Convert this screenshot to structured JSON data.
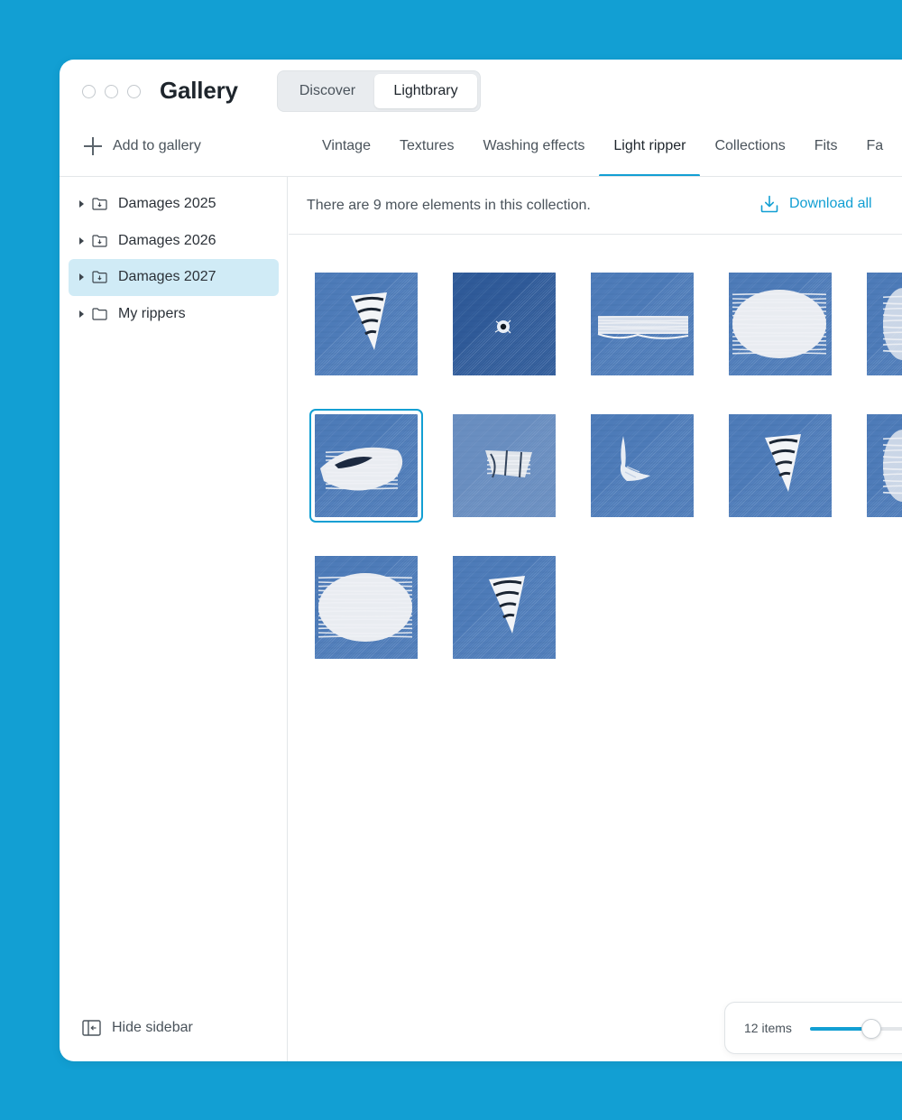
{
  "window": {
    "title": "Gallery",
    "segments": [
      {
        "label": "Discover",
        "active": false
      },
      {
        "label": "Lightbrary",
        "active": true
      }
    ]
  },
  "toolbar": {
    "add_label": "Add to gallery"
  },
  "tabs": [
    {
      "label": "Vintage",
      "active": false
    },
    {
      "label": "Textures",
      "active": false
    },
    {
      "label": "Washing effects",
      "active": false
    },
    {
      "label": "Light ripper",
      "active": true
    },
    {
      "label": "Collections",
      "active": false
    },
    {
      "label": "Fits",
      "active": false
    },
    {
      "label": "Fa",
      "active": false
    }
  ],
  "sidebar": {
    "items": [
      {
        "label": "Damages 2025",
        "icon": "folder-download-icon",
        "selected": false
      },
      {
        "label": "Damages 2026",
        "icon": "folder-download-icon",
        "selected": false
      },
      {
        "label": "Damages 2027",
        "icon": "folder-download-icon",
        "selected": true
      },
      {
        "label": "My rippers",
        "icon": "folder-icon",
        "selected": false
      }
    ],
    "hide_label": "Hide sidebar"
  },
  "main": {
    "info_text": "There are 9 more elements in this collection.",
    "download_label": "Download all",
    "thumbnails": [
      {
        "variant": "wedge",
        "selected": false
      },
      {
        "variant": "hole",
        "selected": false
      },
      {
        "variant": "stripe",
        "selected": false
      },
      {
        "variant": "big",
        "selected": false
      },
      {
        "variant": "partial",
        "selected": false
      },
      {
        "variant": "eye",
        "selected": true
      },
      {
        "variant": "frayed",
        "selected": false
      },
      {
        "variant": "sparse",
        "selected": false
      },
      {
        "variant": "wedge",
        "selected": false
      },
      {
        "variant": "partial",
        "selected": false
      },
      {
        "variant": "big",
        "selected": false
      },
      {
        "variant": "wedge",
        "selected": false
      }
    ]
  },
  "zoom": {
    "count_label": "12 items",
    "level": 0.45
  },
  "colors": {
    "accent": "#129fd3",
    "selected_bg": "#d0ebf6",
    "denim": "#3f6ba8"
  }
}
